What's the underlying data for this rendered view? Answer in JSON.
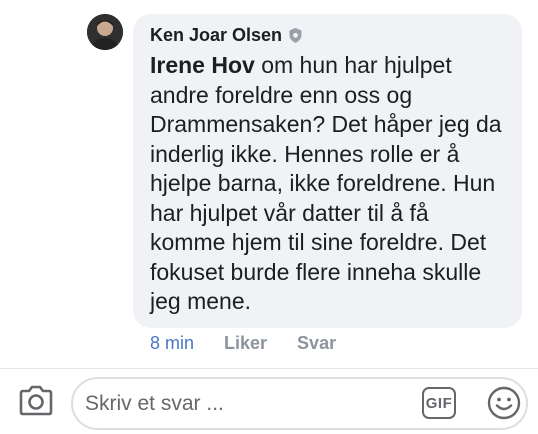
{
  "comment": {
    "author": "Ken Joar Olsen",
    "mention": "Irene Hov",
    "text": " om hun har hjulpet andre foreldre enn oss og Drammensaken? Det håper jeg da inderlig ikke. Hennes rolle er å hjelpe barna, ikke foreldrene. Hun har hjulpet vår datter til å få komme hjem til sine foreldre. Det fokuset burde flere inneha skulle jeg mene.",
    "time": "8 min",
    "like_label": "Liker",
    "reply_label": "Svar"
  },
  "composer": {
    "placeholder": "Skriv et svar ...",
    "gif_label": "GIF"
  },
  "icons": {
    "avatar": "avatar",
    "badge": "shield-icon",
    "camera": "camera-icon",
    "emoji": "smiley-icon"
  },
  "colors": {
    "bubble": "#f0f2f5",
    "time_link": "#4a76c9",
    "muted": "#8d949e"
  }
}
